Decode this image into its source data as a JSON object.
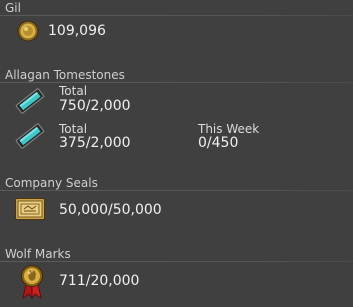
{
  "gil": {
    "header": "Gil",
    "amount": "109,096",
    "icon": "gil-coin-icon"
  },
  "tomestones": {
    "header": "Allagan Tomestones",
    "rows": [
      {
        "icon": "tomestone-icon",
        "total_label": "Total",
        "total_value": "750/2,000"
      },
      {
        "icon": "tomestone-icon",
        "total_label": "Total",
        "total_value": "375/2,000",
        "week_label": "This Week",
        "week_value": "0/450"
      }
    ]
  },
  "company_seals": {
    "header": "Company Seals",
    "amount": "50,000/50,000",
    "icon": "company-seal-icon"
  },
  "wolf_marks": {
    "header": "Wolf Marks",
    "amount": "711/20,000",
    "icon": "wolf-mark-medal-icon"
  },
  "colors": {
    "background": "#404040",
    "tomestone_accent": "#3ec9c9",
    "gold": "#c9a13a"
  }
}
